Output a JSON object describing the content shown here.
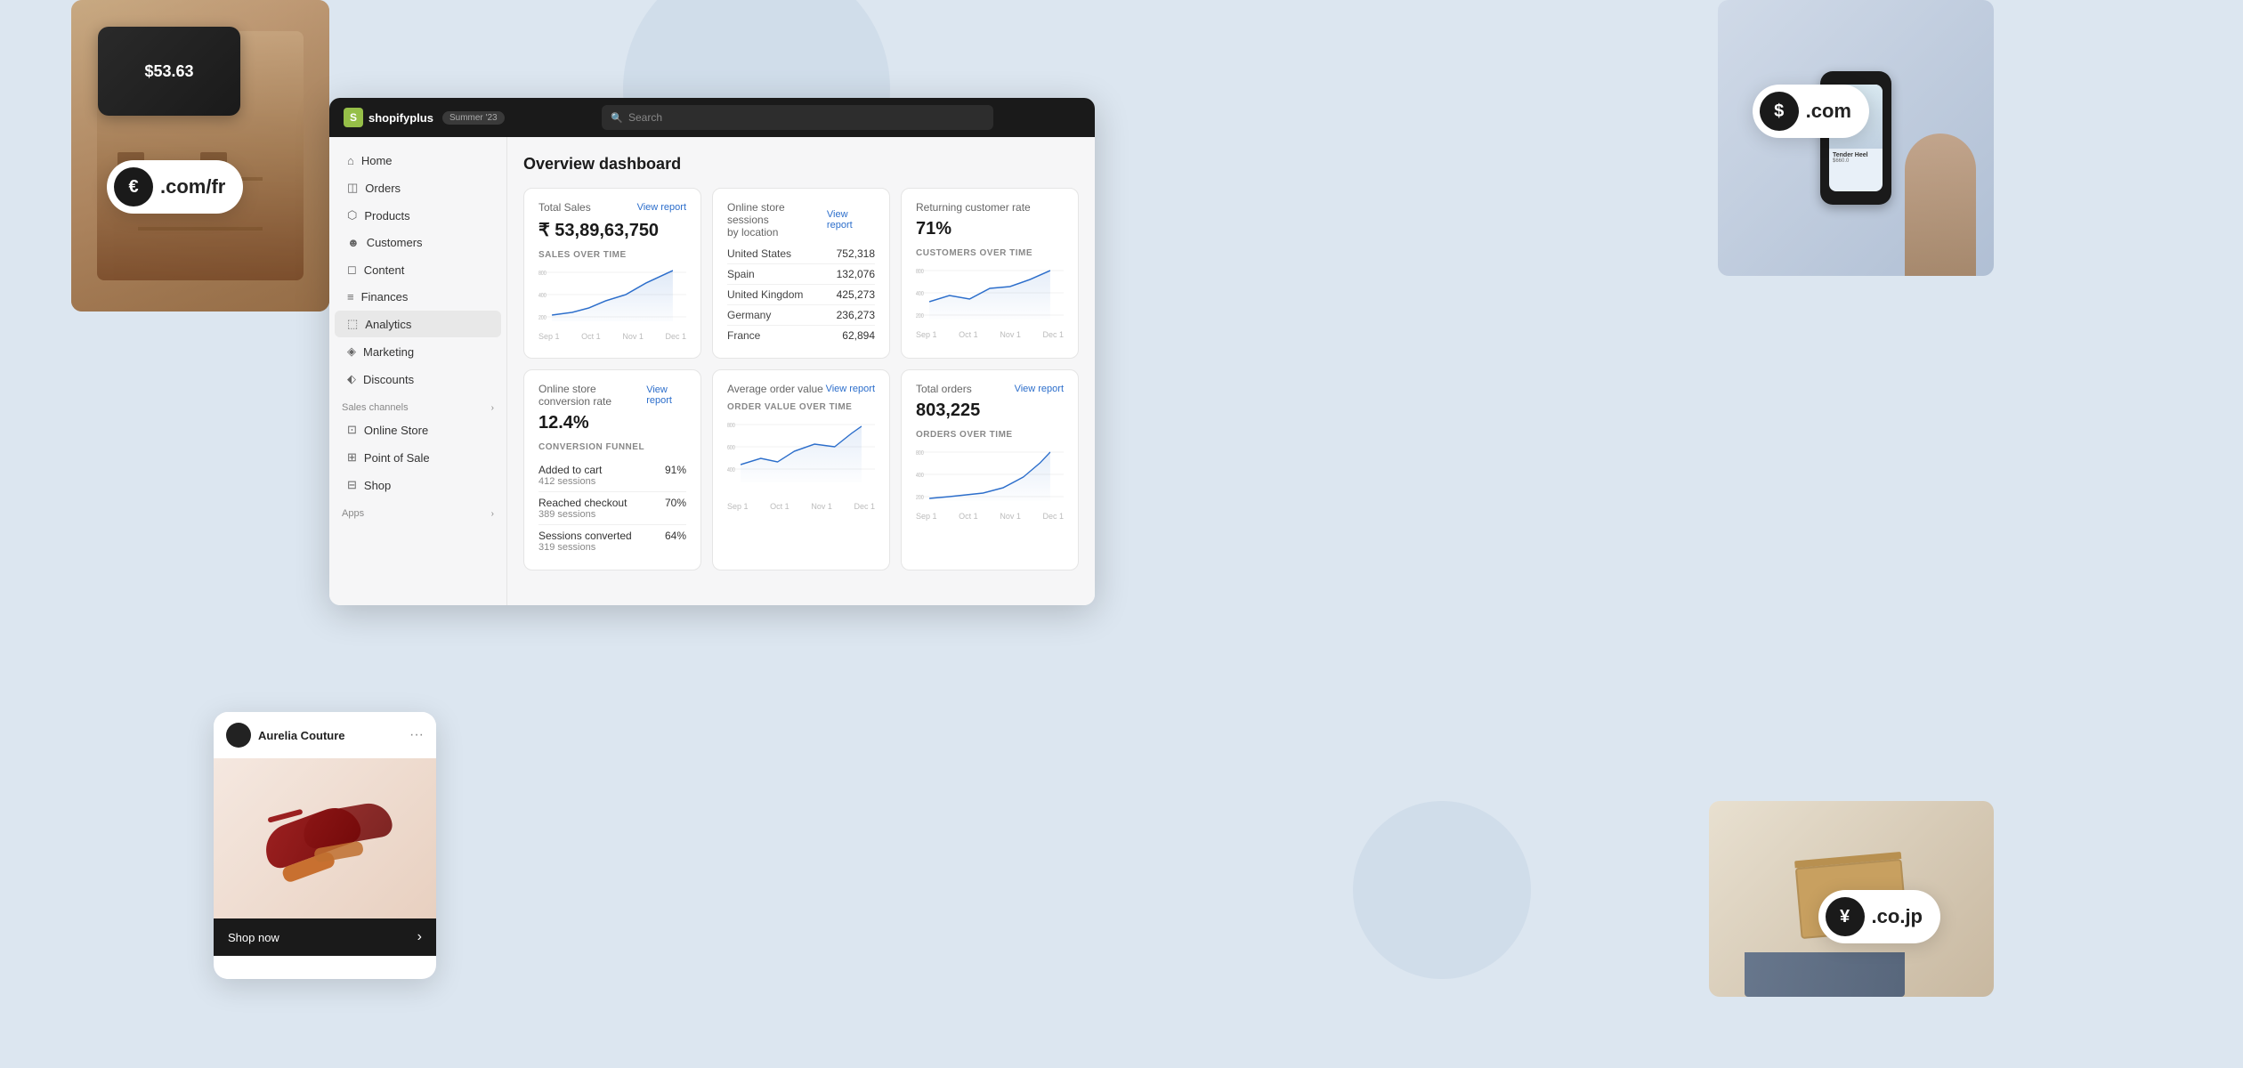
{
  "page": {
    "background_color": "#dce6f0",
    "title": "Shopify Plus Dashboard"
  },
  "topbar": {
    "logo_text": "shopify",
    "plus_text": "plus",
    "summer_badge": "Summer '23",
    "search_placeholder": "Search"
  },
  "sidebar": {
    "nav_items": [
      {
        "id": "home",
        "label": "Home",
        "icon": "🏠"
      },
      {
        "id": "orders",
        "label": "Orders",
        "icon": "📦"
      },
      {
        "id": "products",
        "label": "Products",
        "icon": "🏷️"
      },
      {
        "id": "customers",
        "label": "Customers",
        "icon": "👤"
      },
      {
        "id": "content",
        "label": "Content",
        "icon": "📄"
      },
      {
        "id": "finances",
        "label": "Finances",
        "icon": "💰"
      },
      {
        "id": "analytics",
        "label": "Analytics",
        "icon": "📊"
      },
      {
        "id": "marketing",
        "label": "Marketing",
        "icon": "📣"
      },
      {
        "id": "discounts",
        "label": "Discounts",
        "icon": "🏷"
      }
    ],
    "sales_channels_title": "Sales channels",
    "sales_channels": [
      {
        "id": "online-store",
        "label": "Online Store",
        "icon": "🌐"
      },
      {
        "id": "point-of-sale",
        "label": "Point of Sale",
        "icon": "🏪"
      },
      {
        "id": "shop",
        "label": "Shop",
        "icon": "🛍️"
      }
    ],
    "apps_title": "Apps"
  },
  "dashboard": {
    "title": "Overview dashboard",
    "cards": {
      "total_sales": {
        "title": "Total Sales",
        "value": "₹ 53,89,63,750",
        "chart_label": "SALES OVER TIME",
        "view_report": "View report",
        "axis_ticks": [
          "Sep 1",
          "Oct 1",
          "Nov 1",
          "Dec 1"
        ]
      },
      "online_sessions": {
        "title": "Online store sessions by location",
        "view_report": "View report",
        "locations": [
          {
            "name": "United States",
            "value": "752,318"
          },
          {
            "name": "Spain",
            "value": "132,076"
          },
          {
            "name": "United Kingdom",
            "value": "425,273"
          },
          {
            "name": "Germany",
            "value": "236,273"
          },
          {
            "name": "France",
            "value": "62,894"
          }
        ]
      },
      "returning_customer": {
        "title": "Returning customer rate",
        "value": "71%",
        "chart_label": "CUSTOMERS OVER TIME",
        "axis_ticks": [
          "Sep 1",
          "Oct 1",
          "Nov 1",
          "Dec 1"
        ]
      },
      "conversion_rate": {
        "title": "Online store conversion rate",
        "value": "12.4%",
        "view_report": "View report",
        "funnel_label": "CONVERSION FUNNEL",
        "funnel_items": [
          {
            "name": "Added to cart",
            "sessions": "412 sessions",
            "pct": "91%"
          },
          {
            "name": "Reached checkout",
            "sessions": "389 sessions",
            "pct": "70%"
          },
          {
            "name": "Sessions converted",
            "sessions": "319 sessions",
            "pct": "64%"
          }
        ]
      },
      "avg_order_value": {
        "title": "Average order value",
        "view_report": "View report",
        "chart_label": "ORDER VALUE OVER TIME",
        "axis_ticks": [
          "Sep 1",
          "Oct 1",
          "Nov 1",
          "Dec 1"
        ]
      },
      "total_orders": {
        "title": "Total orders",
        "value": "803,225",
        "view_report": "View report",
        "chart_label": "ORDERS OVER TIME",
        "axis_ticks": [
          "Sep 1",
          "Oct 1",
          "Nov 1",
          "Dec 1"
        ]
      }
    }
  },
  "fashion_card": {
    "store_name": "Aurelia Couture",
    "shop_now": "Shop now"
  },
  "currency_badges": {
    "euro": {
      "symbol": "€",
      "text": ".com/fr"
    },
    "dollar": {
      "symbol": "$",
      "text": ".com"
    },
    "yen": {
      "symbol": "¥",
      "text": ".co.jp"
    }
  },
  "payment_terminal": {
    "amount": "$53.63"
  }
}
